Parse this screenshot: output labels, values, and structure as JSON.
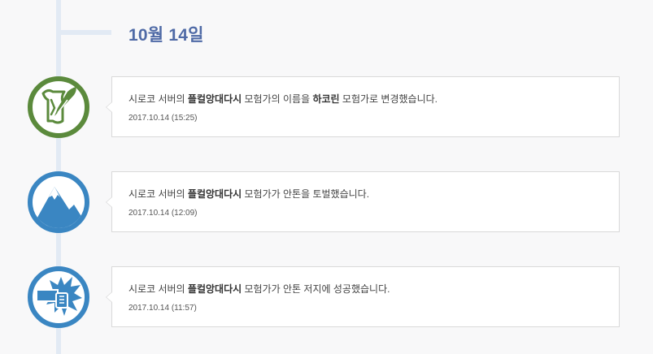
{
  "date_header": "10월 14일",
  "entries": [
    {
      "icon": "quill-scroll-icon",
      "icon_color": "#5b8a3c",
      "text_before": "시로코 서버의 ",
      "character": "플컬앙대다시",
      "text_middle": " 모험가의 이름을 ",
      "new_name": "하코린",
      "text_after": " 모험가로 변경했습니다.",
      "timestamp": "2017.10.14 (15:25)"
    },
    {
      "icon": "mountain-icon",
      "icon_color": "#3a86c2",
      "text_before": "시로코 서버의 ",
      "character": "플컬앙대다시",
      "text_after": " 모험가가 안톤을 토벌했습니다.",
      "timestamp": "2017.10.14 (12:09)"
    },
    {
      "icon": "explosion-fist-icon",
      "icon_color": "#3a86c2",
      "text_before": "시로코 서버의 ",
      "character": "플컬앙대다시",
      "text_after": " 모험가가 안톤 저지에 성공했습니다.",
      "timestamp": "2017.10.14 (11:57)"
    }
  ]
}
